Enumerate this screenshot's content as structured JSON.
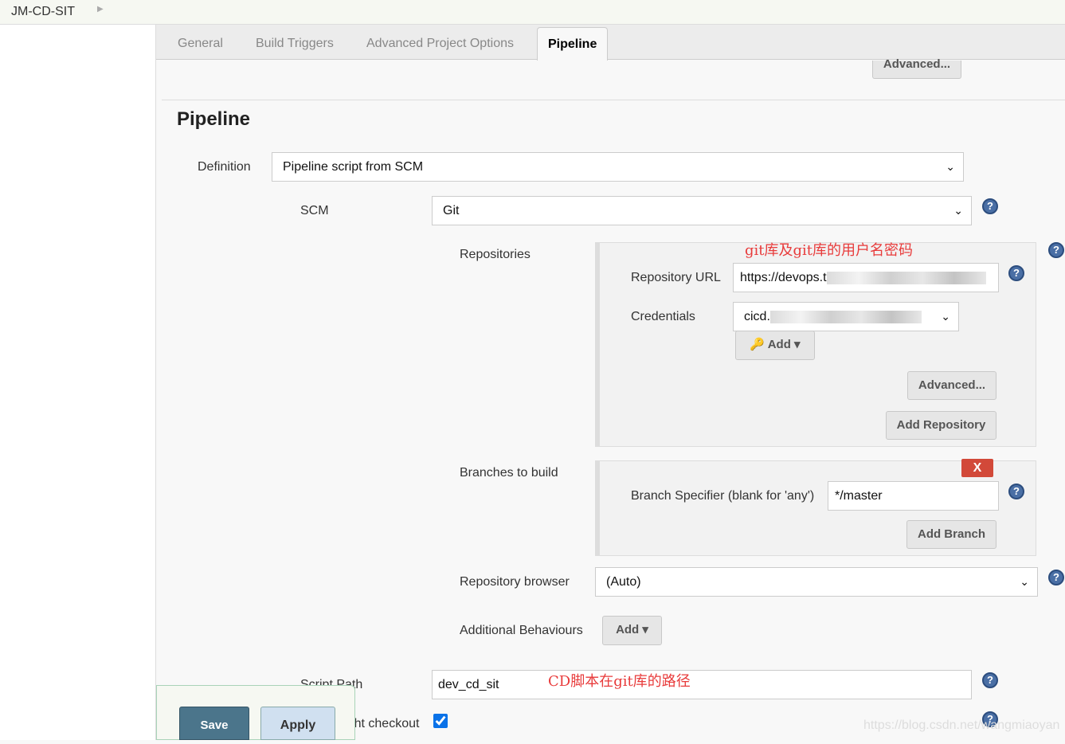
{
  "breadcrumb": {
    "project": "JM-CD-SIT"
  },
  "tabs": [
    {
      "label": "General"
    },
    {
      "label": "Build Triggers"
    },
    {
      "label": "Advanced Project Options"
    },
    {
      "label": "Pipeline"
    }
  ],
  "top_advanced": "Advanced...",
  "section_title": "Pipeline",
  "definition": {
    "label": "Definition",
    "value": "Pipeline script from SCM"
  },
  "scm": {
    "label": "SCM",
    "value": "Git"
  },
  "repositories": {
    "label": "Repositories",
    "annotation": "git库及git库的用户名密码",
    "url_label": "Repository URL",
    "url_value": "https://devops.t",
    "credentials_label": "Credentials",
    "credentials_value": "cicd.",
    "add": "Add",
    "advanced": "Advanced...",
    "add_repository": "Add Repository"
  },
  "branches": {
    "label": "Branches to build",
    "delete": "X",
    "specifier_label": "Branch Specifier (blank for 'any')",
    "specifier_value": "*/master",
    "add_branch": "Add Branch"
  },
  "repo_browser": {
    "label": "Repository browser",
    "value": "(Auto)"
  },
  "behaviours": {
    "label": "Additional Behaviours",
    "add": "Add"
  },
  "script_path": {
    "label": "Script Path",
    "value": "dev_cd_sit",
    "annotation": "CD脚本在git库的路径"
  },
  "lightweight": {
    "label": "Lightweight checkout",
    "checked": true
  },
  "footer": {
    "save": "Save",
    "apply": "Apply"
  },
  "watermark": "https://blog.csdn.net/wangmiaoyan",
  "colors": {
    "save": "#4b758b",
    "apply": "#d0e0f0",
    "annotation": "#e83b3b",
    "help": "#4a6fa5"
  }
}
